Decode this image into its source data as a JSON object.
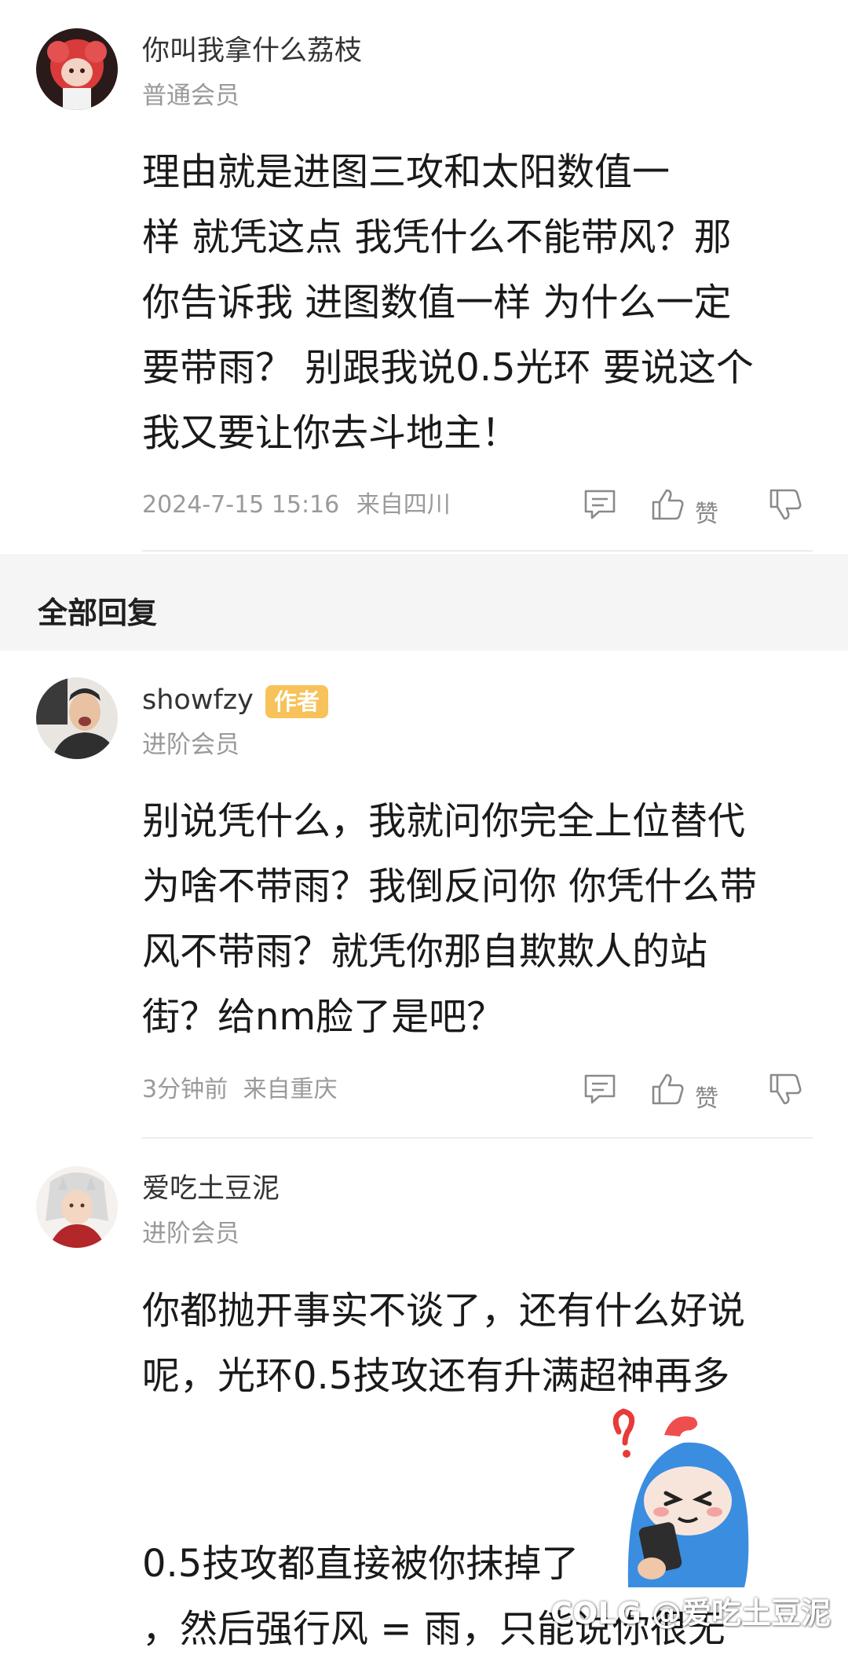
{
  "main_comment": {
    "username": "你叫我拿什么荔枝",
    "level": "普通会员",
    "lines": [
      "理由就是进图三攻和太阳数值一",
      "样  就凭这点 我凭什么不能带风？那",
      "你告诉我  进图数值一样  为什么一定",
      "要带雨？  别跟我说0.5光环  要说这个",
      "我又要让你去斗地主！"
    ],
    "time": "2024-7-15 15:16",
    "location": "来自四川",
    "like_label": "赞"
  },
  "section": {
    "title": "全部回复"
  },
  "replies": [
    {
      "username": "showfzy",
      "badge": "作者",
      "level": "进阶会员",
      "lines": [
        "别说凭什么，我就问你完全上位替代",
        "为啥不带雨？我倒反问你 你凭什么带",
        "风不带雨？就凭你那自欺欺人的站",
        "街？给nm脸了是吧？"
      ],
      "time": "3分钟前",
      "location": "来自重庆",
      "like_label": "赞"
    },
    {
      "username": "爱吃土豆泥",
      "level": "进阶会员",
      "lines": [
        "你都抛开事实不谈了，还有什么好说",
        "呢，光环0.5技攻还有升满超神再多",
        "",
        "0.5技攻都直接被你抹掉了",
        "，然后强行风 = 雨，只能说你很无"
      ]
    }
  ],
  "watermark": "COLG @爱吃土豆泥",
  "colors": {
    "badge": "#f8c25a",
    "section_bg": "#f5f5f5",
    "meta_text": "#9a9a9a"
  },
  "icons": [
    "reply-icon",
    "thumbs-up-icon",
    "thumbs-down-icon"
  ]
}
